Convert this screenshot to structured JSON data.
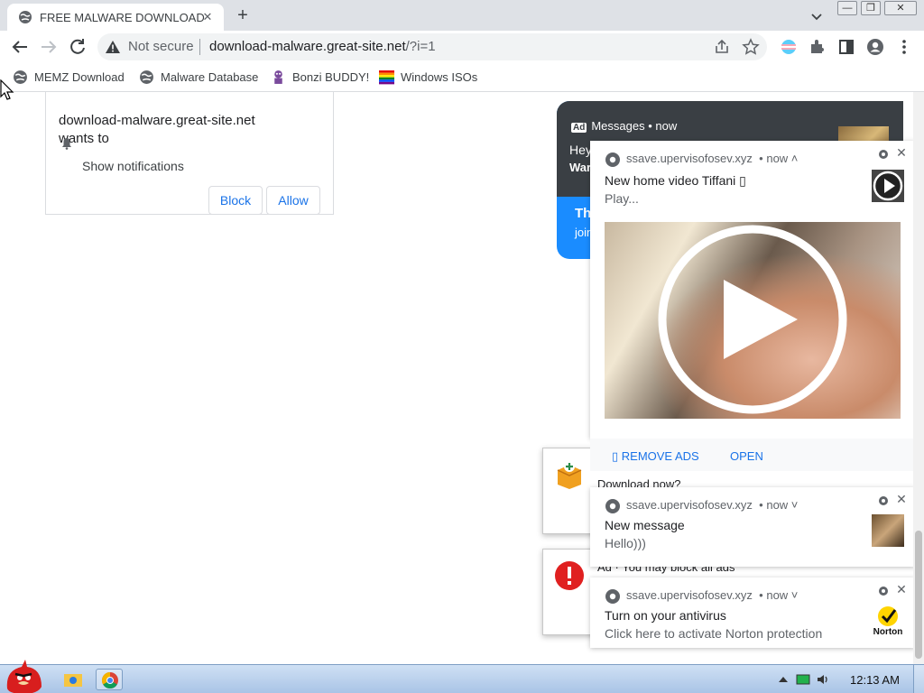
{
  "browser": {
    "tab": {
      "title": "FREE MALWARE DOWNLOAD",
      "close": "✕"
    },
    "new_tab": "+",
    "window_controls": {
      "minimize": "—",
      "restore": "❐",
      "close": "✕"
    },
    "omnibox": {
      "security": "Not secure",
      "url_host": "download-malware.great-site.net",
      "url_path": "/?i=1"
    },
    "bookmarks": [
      {
        "label": "MEMZ Download",
        "icon": "globe-icon"
      },
      {
        "label": "Malware Database",
        "icon": "globe-icon"
      },
      {
        "label": "Bonzi BUDDY!",
        "icon": "bonzi-icon"
      },
      {
        "label": "Windows ISOs",
        "icon": "windows-flag-icon"
      }
    ]
  },
  "permission_prompt": {
    "site": "download-malware.great-site.net",
    "wants": "wants to",
    "request": "Show notifications",
    "block": "Block",
    "allow": "Allow"
  },
  "background_ad": {
    "badge": "Ad",
    "label": "Messages • now",
    "line1": "Hey",
    "line2": "War",
    "line3": "Th",
    "line4": "join"
  },
  "background_cards": [
    {
      "text": "Download now?"
    },
    {
      "text": "Ad · You may block all ads"
    }
  ],
  "notifications": [
    {
      "source": "ssave.upervisofosev.xyz",
      "time": "• now ˄",
      "title": "New home video Tiffani ▯",
      "message": "Play...",
      "actions": [
        "▯ REMOVE ADS",
        "OPEN"
      ]
    },
    {
      "source": "ssave.upervisofosev.xyz",
      "time": "• now ˅",
      "title": "New message",
      "message": "Hello)))"
    },
    {
      "source": "ssave.upervisofosev.xyz",
      "time": "• now ˅",
      "title": "Turn on your antivirus",
      "message": "Click here to activate Norton protection",
      "badge_text": "Norton"
    }
  ],
  "taskbar": {
    "clock": "12:13 AM"
  },
  "colors": {
    "link_blue": "#1a73e8",
    "ad_blue": "#1a8cff",
    "ad_dark": "#3a3f44",
    "tab_strip": "#dee1e6"
  }
}
